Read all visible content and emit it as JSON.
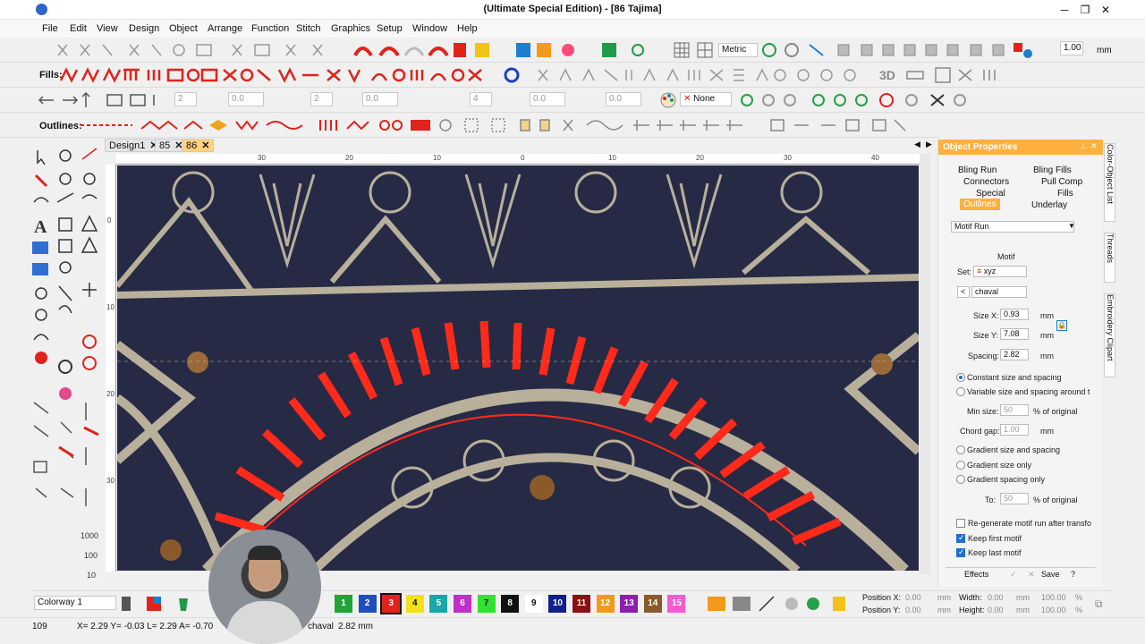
{
  "window": {
    "title": "(Ultimate Special Edition) - [86          Tajima]",
    "minimize": "─",
    "restore": "❐",
    "close": "✕"
  },
  "menu": [
    "File",
    "Edit",
    "View",
    "Design",
    "Object",
    "Arrange",
    "Function",
    "Stitch",
    "Graphics",
    "Setup",
    "Window",
    "Help"
  ],
  "toolbar1": {
    "units": "Metric",
    "zoom_value": "1.00",
    "zoom_unit": "mm"
  },
  "toolbar2": {
    "fills_label": "Fills:",
    "tool_3d": "3D"
  },
  "toolbar3": {
    "none_label": "None"
  },
  "toolbar4": {
    "outlines_label": "Outlines:"
  },
  "tabs": [
    {
      "label": "Design1"
    },
    {
      "label": "85"
    },
    {
      "label": "86"
    }
  ],
  "ruler_h": [
    "30",
    "20",
    "10",
    "0",
    "10",
    "20",
    "30",
    "40"
  ],
  "ruler_v": [
    "0",
    "10",
    "20",
    "30"
  ],
  "props": {
    "header": "Object Properties",
    "tabs": [
      "Bling Run",
      "Bling Fills",
      "Connectors",
      "Pull Comp",
      "Special",
      "Fills",
      "Outlines",
      "Underlay"
    ],
    "active_tab": "Outlines",
    "type": "Motif Run",
    "motif_title": "Motif",
    "set_label": "Set:",
    "set_value": "xyz",
    "pattern_value": "chaval",
    "size_x_label": "Size X:",
    "size_x": "0.93",
    "size_y_label": "Size Y:",
    "size_y": "7.08",
    "spacing_label": "Spacing:",
    "spacing": "2.82",
    "unit_mm": "mm",
    "opt_constant": "Constant size and spacing",
    "opt_variable": "Variable size and spacing around t",
    "min_size_label": "Min size:",
    "min_size": "50",
    "of_original": "% of original",
    "chord_gap_label": "Chord gap:",
    "chord_gap": "1.00",
    "opt_gradient_both": "Gradient size and spacing",
    "opt_gradient_size": "Gradient size only",
    "opt_gradient_spacing": "Gradient spacing only",
    "to_label": "To:",
    "to_value": "50",
    "regen_label": "Re-generate motif run after transfo",
    "keep_first": "Keep first motif",
    "keep_last": "Keep last motif",
    "effects_btn": "Effects",
    "save_btn": "Save",
    "help_btn": "?"
  },
  "sidetabs": [
    "Color-Object List",
    "Threads",
    "Embroidery Clipart"
  ],
  "bottom": {
    "colorway": "Colorway 1",
    "swatches": [
      {
        "n": "1",
        "c": "#22a338"
      },
      {
        "n": "2",
        "c": "#1f4fbf"
      },
      {
        "n": "3",
        "c": "#e0231b"
      },
      {
        "n": "4",
        "c": "#f3e21a"
      },
      {
        "n": "5",
        "c": "#1aa6a6"
      },
      {
        "n": "6",
        "c": "#c02fc9"
      },
      {
        "n": "7",
        "c": "#31e231"
      },
      {
        "n": "8",
        "c": "#111111"
      },
      {
        "n": "9",
        "c": "#ffffff"
      },
      {
        "n": "10",
        "c": "#0e1f8f"
      },
      {
        "n": "11",
        "c": "#8b1010"
      },
      {
        "n": "12",
        "c": "#f39a1d"
      },
      {
        "n": "13",
        "c": "#8c1fb0"
      },
      {
        "n": "14",
        "c": "#8a5a2b"
      },
      {
        "n": "15",
        "c": "#f35bd0"
      }
    ],
    "position_x_label": "Position X:",
    "position_x": "0.00",
    "position_y_label": "Position Y:",
    "position_y": "0.00",
    "width_label": "Width:",
    "width": "0.00",
    "height_label": "Height:",
    "height": "0.00",
    "unit_mm": "mm",
    "percent_w": "100.00",
    "percent_h": "100.00",
    "percent_sign": "%"
  },
  "status": {
    "count": "109",
    "coords": "X=  2.29 Y=  -0.03 L=  2.29 A=  -0.70",
    "motif": "chaval",
    "spacing": "2.82 mm"
  }
}
